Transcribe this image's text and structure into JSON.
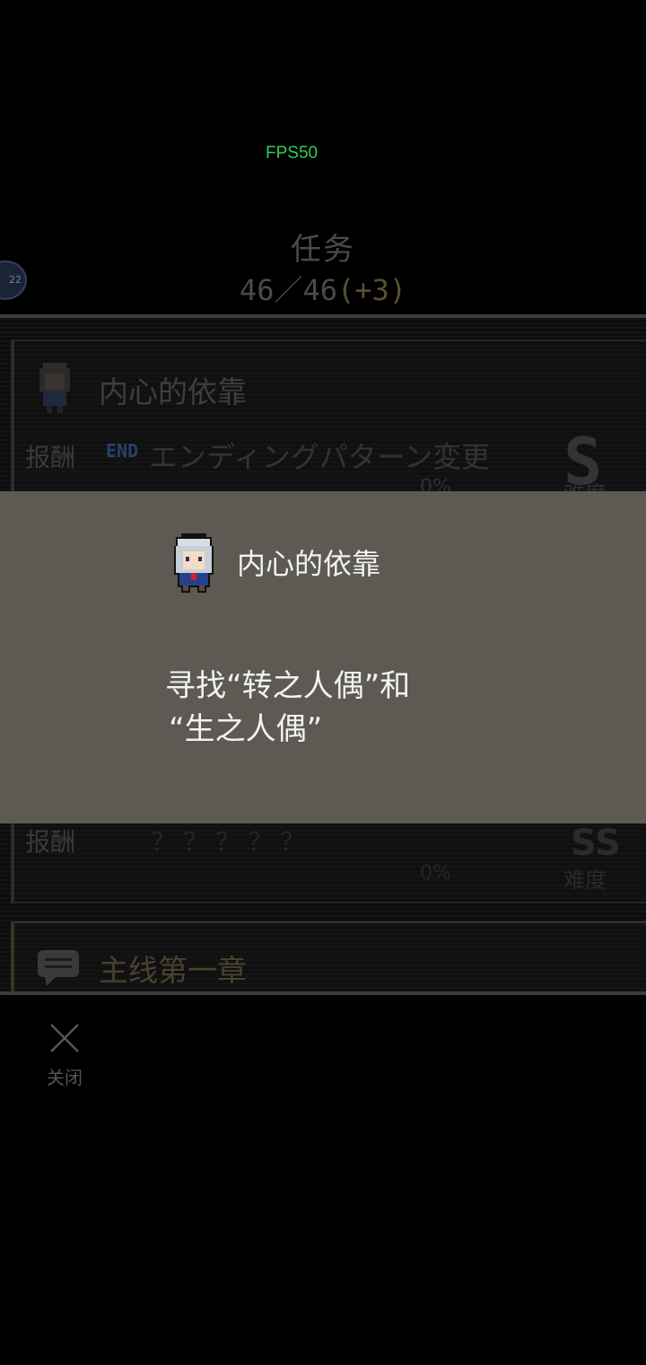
{
  "fps": "FPS50",
  "header": {
    "title": "任务",
    "count": "46／46",
    "bonus": "(+3)",
    "badge": "22"
  },
  "quests": [
    {
      "title": "内心的依靠",
      "reward_label": "报酬",
      "reward_tag": "END",
      "reward_text": "エンディングパターン変更",
      "grade": "S",
      "percent": "0%",
      "difficulty_label": "难度"
    },
    {
      "reward_label": "报酬",
      "reward_text": "？？？？？",
      "grade": "SS",
      "percent": "0%",
      "difficulty_label": "难度"
    },
    {
      "title": "主线第一章"
    }
  ],
  "modal": {
    "title": "内心的依靠",
    "description_line1": "寻找“转之人偶”和",
    "description_line2": "“生之人偶”"
  },
  "close": {
    "label": "关闭"
  }
}
